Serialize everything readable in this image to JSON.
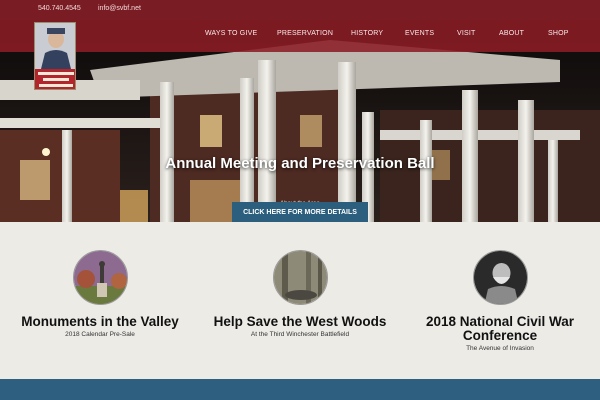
{
  "header": {
    "phone": "540.740.4545",
    "email": "info@svbf.net",
    "logo_icon": "shenandoah-valley-battlefields-logo",
    "nav": [
      {
        "label": "WAYS TO GIVE"
      },
      {
        "label": "PRESERVATION"
      },
      {
        "label": "HISTORY"
      },
      {
        "label": "EVENTS"
      },
      {
        "label": "VISIT"
      },
      {
        "label": "ABOUT"
      },
      {
        "label": "SHOP"
      }
    ]
  },
  "hero": {
    "title": "Annual Meeting and Preservation Ball",
    "subtitle": "About the Area",
    "cta_label": "CLICK HERE FOR MORE DETAILS"
  },
  "features": [
    {
      "title": "Monuments in the Valley",
      "subtitle": "2018 Calendar Pre-Sale"
    },
    {
      "title": "Help Save the West Woods",
      "subtitle": "At the Third Winchester Battlefield"
    },
    {
      "title": "2018 National Civil War Conference",
      "subtitle": "The Avenue of Invasion"
    }
  ],
  "colors": {
    "topbar": "#7a1c24",
    "nav_band": "#8c1c26",
    "cta": "#2c5e7d",
    "footer_band": "#2f5f80"
  }
}
